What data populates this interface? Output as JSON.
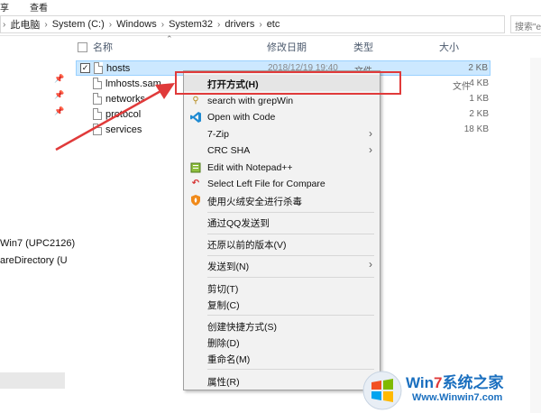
{
  "ribbon": {
    "tab_share": "享",
    "tab_view": "查看"
  },
  "address": {
    "crumbs": [
      "此电脑",
      "System (C:)",
      "Windows",
      "System32",
      "drivers",
      "etc"
    ],
    "separator": "›",
    "nav_chevron": "›",
    "search_placeholder": "搜索\"etc\""
  },
  "nav": {
    "item_1": "Win7 (UPC2126)",
    "item_2": "areDirectory (U"
  },
  "columns": {
    "name": "名称",
    "date": "修改日期",
    "type": "类型",
    "size": "大小"
  },
  "files": [
    {
      "name": "hosts",
      "date": "2018/12/19 19:40",
      "type": "文件",
      "size": "2 KB",
      "checked": "✓"
    },
    {
      "name": "lmhosts.sam",
      "date": "",
      "type": "文件",
      "size": "4 KB",
      "checked": ""
    },
    {
      "name": "networks",
      "date": "",
      "type": "",
      "size": "1 KB",
      "checked": ""
    },
    {
      "name": "protocol",
      "date": "",
      "type": "",
      "size": "2 KB",
      "checked": ""
    },
    {
      "name": "services",
      "date": "",
      "type": "",
      "size": "18 KB",
      "checked": ""
    }
  ],
  "menu": {
    "open_with": "打开方式(H)",
    "grepwin": "search with grepWin",
    "open_code": "Open with Code",
    "seven_zip": "7-Zip",
    "crc_sha": "CRC SHA",
    "notepadpp": "Edit with Notepad++",
    "compare": "Select Left File for Compare",
    "huorong": "使用火绒安全进行杀毒",
    "qq_send": "通过QQ发送到",
    "restore": "还原以前的版本(V)",
    "send_to": "发送到(N)",
    "cut": "剪切(T)",
    "copy": "复制(C)",
    "shortcut": "创建快捷方式(S)",
    "delete": "删除(D)",
    "rename": "重命名(M)",
    "properties": "属性(R)",
    "submenu_arrow": "›"
  },
  "watermark": {
    "brand_a": "Win",
    "brand_7": "7",
    "brand_b": "系统之家",
    "url": "Www.Winwin7.com"
  },
  "colors": {
    "highlight_box": "#e03a3a",
    "selection": "#cce8ff",
    "menu_bg": "#f2f2f2",
    "brand_blue": "#1a6fbf"
  }
}
